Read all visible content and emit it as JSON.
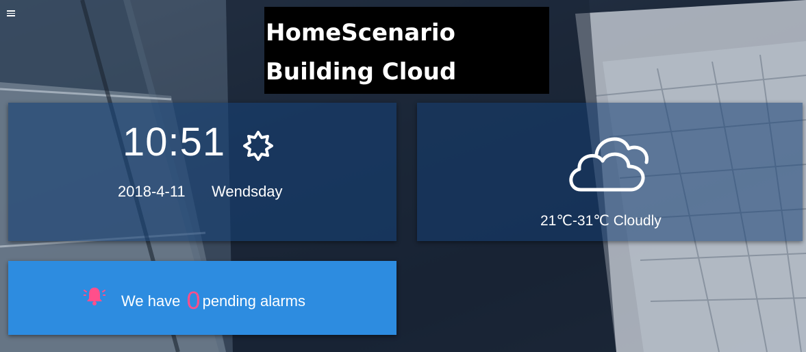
{
  "header": {
    "title_line1": "HomeScenario",
    "title_line2": "Building Cloud",
    "menu_icon": "hamburger-menu-icon"
  },
  "clock": {
    "time": "10:51",
    "date": "2018-4-11",
    "weekday": "Wendsday",
    "icon": "sun-icon"
  },
  "weather": {
    "summary": "21℃-31℃ Cloudly",
    "icon": "cloud-icon"
  },
  "alarms": {
    "prefix": "We have",
    "count": "0",
    "suffix": "pending alarms",
    "icon": "alarm-bell-icon"
  },
  "colors": {
    "card_blue": "#16406f",
    "alarm_blue": "#2d8ce0",
    "alarm_count": "#ff4f8b",
    "title_bg": "#000000"
  }
}
